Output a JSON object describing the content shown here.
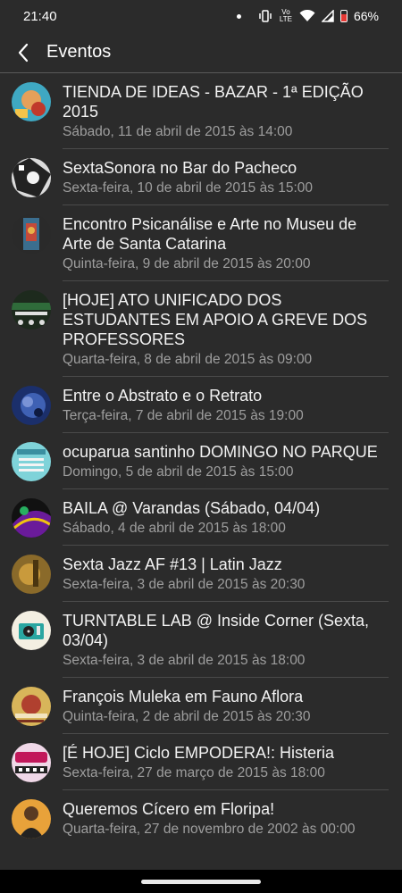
{
  "status": {
    "time": "21:40",
    "volte": "Vo LTE",
    "battery": "66%"
  },
  "appbar": {
    "title": "Eventos"
  },
  "events": [
    {
      "title": "TIENDA DE IDEAS - BAZAR - 1ª EDIÇÃO 2015",
      "date": "Sábado, 11 de abril de 2015 às 14:00"
    },
    {
      "title": "SextaSonora no Bar do Pacheco",
      "date": "Sexta-feira, 10 de abril de 2015 às 15:00"
    },
    {
      "title": "Encontro Psicanálise e Arte no Museu de Arte de Santa Catarina",
      "date": "Quinta-feira, 9 de abril de 2015 às 20:00"
    },
    {
      "title": "[HOJE] ATO UNIFICADO DOS ESTUDANTES EM APOIO A GREVE DOS PROFESSORES",
      "date": "Quarta-feira, 8 de abril de 2015 às 09:00"
    },
    {
      "title": "Entre o Abstrato e o Retrato",
      "date": "Terça-feira, 7 de abril de 2015 às 19:00"
    },
    {
      "title": "ocuparua santinho DOMINGO NO PARQUE",
      "date": "Domingo, 5 de abril de 2015 às 15:00"
    },
    {
      "title": "BAILA @ Varandas (Sábado, 04/04)",
      "date": "Sábado, 4 de abril de 2015 às 18:00"
    },
    {
      "title": "Sexta Jazz AF #13 | Latin Jazz",
      "date": "Sexta-feira, 3 de abril de 2015 às 20:30"
    },
    {
      "title": "TURNTABLE LAB @ Inside Corner (Sexta, 03/04)",
      "date": "Sexta-feira, 3 de abril de 2015 às 18:00"
    },
    {
      "title": "François Muleka em Fauno Aflora",
      "date": "Quinta-feira, 2 de abril de 2015 às 20:30"
    },
    {
      "title": "[É HOJE] Ciclo EMPODERA!: Histeria",
      "date": "Sexta-feira, 27 de março de 2015 às 18:00"
    },
    {
      "title": "Queremos Cícero em Floripa!",
      "date": "Quarta-feira, 27 de novembro de 2002 às 00:00"
    }
  ]
}
